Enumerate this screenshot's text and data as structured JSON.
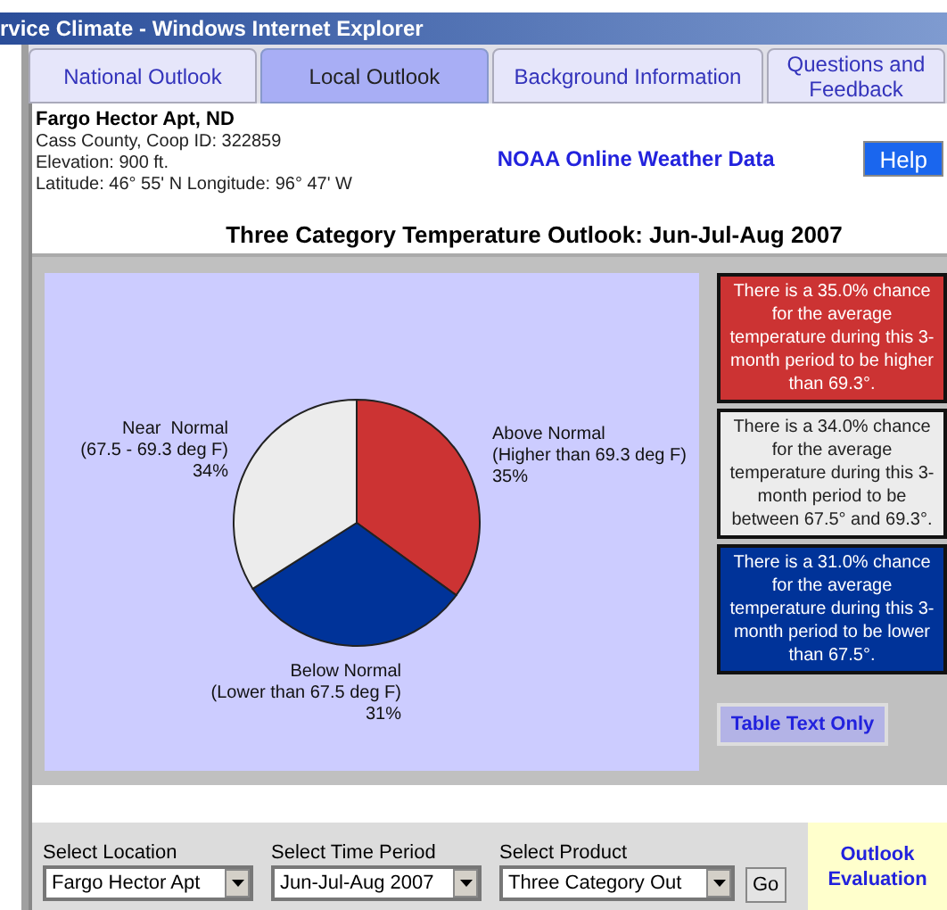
{
  "window": {
    "title": "rvice Climate - Windows Internet Explorer"
  },
  "tabs": [
    {
      "label": "National Outlook",
      "selected": false
    },
    {
      "label": "Local Outlook",
      "selected": true
    },
    {
      "label": "Background Information",
      "selected": false
    },
    {
      "label": "Questions and Feedback",
      "selected": false
    }
  ],
  "station": {
    "name": "Fargo Hector Apt, ND",
    "details": [
      "Cass County, Coop ID: 322859",
      "Elevation: 900 ft.",
      "Latitude: 46° 55' N Longitude: 96° 47' W"
    ]
  },
  "noaa_link": "NOAA Online Weather Data",
  "help_button": "Help",
  "outlook_title": "Three Category Temperature Outlook: Jun-Jul-Aug 2007",
  "chart": {
    "chart_data": {
      "type": "pie",
      "categories": [
        "Above Normal",
        "Below Normal",
        "Near  Normal"
      ],
      "values": [
        35,
        31,
        34
      ],
      "value_labels": [
        "35%",
        "31%",
        "34%"
      ]
    },
    "slices": [
      {
        "range": "(Higher than 69.3 deg F)",
        "color": "#cc3333"
      },
      {
        "range": "(Lower than 67.5 deg F)",
        "color": "#003399"
      },
      {
        "range": "(67.5 - 69.3 deg F)",
        "color": "#ececec"
      }
    ]
  },
  "chance_notes": [
    {
      "text": "There is a 35.0% chance for the average temperature during this 3-month period to be higher than 69.3°.",
      "color": "#cc3333"
    },
    {
      "text": "There is a 34.0% chance for the average temperature during this 3-month period to be between 67.5° and 69.3°.",
      "color": "#ececec"
    },
    {
      "text": "There is a 31.0% chance for the average temperature during this 3-month period to be lower than 67.5°.",
      "color": "#003399"
    }
  ],
  "table_text_button": "Table Text Only",
  "selectors": [
    {
      "label": "Select Location",
      "value": "Fargo Hector Apt"
    },
    {
      "label": "Select Time Period",
      "value": "Jun-Jul-Aug 2007"
    },
    {
      "label": "Select Product",
      "value": "Three Category Out"
    }
  ],
  "go_button": "Go",
  "evaluation_link": "Outlook Evaluation"
}
